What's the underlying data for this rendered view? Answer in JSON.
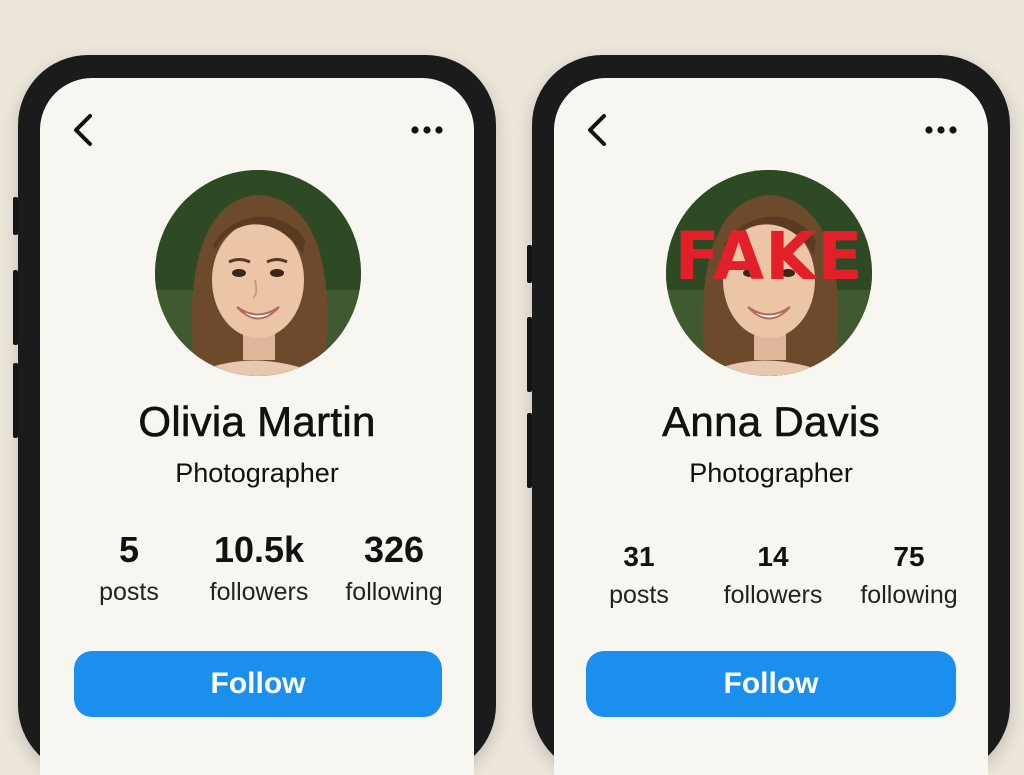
{
  "profiles": [
    {
      "name": "Olivia Martin",
      "title": "Photographer",
      "stats": [
        {
          "value": "5",
          "label": "posts"
        },
        {
          "value": "10.5k",
          "label": "followers"
        },
        {
          "value": "326",
          "label": "following"
        }
      ],
      "follow_label": "Follow",
      "icons": {
        "back": "chevron-left-icon",
        "menu": "more-horizontal-icon"
      }
    },
    {
      "name": "Anna Davis",
      "title": "Photographer",
      "stamp": "FAKE",
      "stats": [
        {
          "value": "31",
          "label": "posts"
        },
        {
          "value": "14",
          "label": "followers"
        },
        {
          "value": "75",
          "label": "following"
        }
      ],
      "follow_label": "Follow",
      "icons": {
        "back": "chevron-left-icon",
        "menu": "more-horizontal-icon"
      }
    }
  ],
  "colors": {
    "accent": "#1a8fed",
    "stamp": "#e3202a",
    "screen": "#f8f6f1",
    "background": "#ece6db"
  }
}
